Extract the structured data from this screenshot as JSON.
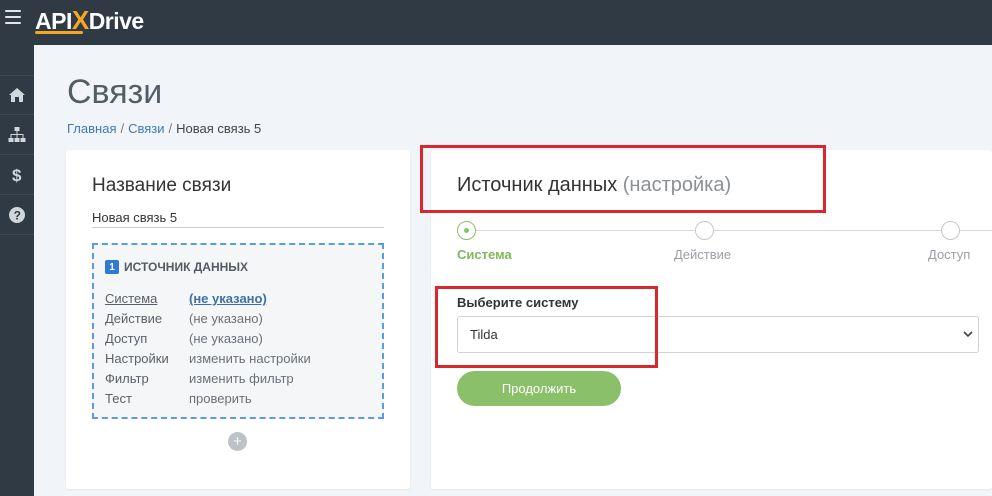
{
  "app": {
    "logo_prefix": "API",
    "logo_x": "X",
    "logo_suffix": "Drive",
    "menu_icon": "hamburger-menu-icon"
  },
  "sidebar": {
    "items": [
      {
        "icon": "home-icon"
      },
      {
        "icon": "sitemap-icon"
      },
      {
        "icon": "dollar-icon"
      },
      {
        "icon": "help-icon"
      }
    ]
  },
  "page": {
    "title": "Связи",
    "breadcrumb": {
      "home": "Главная",
      "links": "Связи",
      "current": "Новая связь 5",
      "separator": "/"
    }
  },
  "left_card": {
    "heading": "Название связи",
    "connection_name": "Новая связь 5",
    "source": {
      "number": "1",
      "title": "ИСТОЧНИК ДАННЫХ",
      "rows": [
        {
          "key": "Система",
          "value": "(не указано)"
        },
        {
          "key": "Действие",
          "value": "(не указано)"
        },
        {
          "key": "Доступ",
          "value": "(не указано)"
        },
        {
          "key": "Настройки",
          "value": "изменить настройки"
        },
        {
          "key": "Фильтр",
          "value": "изменить фильтр"
        },
        {
          "key": "Тест",
          "value": "проверить"
        }
      ]
    },
    "add_label": "+"
  },
  "right_card": {
    "heading": "Источник данных",
    "heading_muted": "(настройка)",
    "steps": [
      {
        "label": "Система",
        "active": true
      },
      {
        "label": "Действие",
        "active": false
      },
      {
        "label": "Доступ",
        "active": false
      }
    ],
    "select_label": "Выберите систему",
    "select_value": "Tilda",
    "continue_label": "Продолжить"
  },
  "colors": {
    "topbar": "#2f3a45",
    "accent_green": "#8bc06b",
    "link_blue": "#3d7ab8",
    "highlight_red": "#d9272d"
  }
}
